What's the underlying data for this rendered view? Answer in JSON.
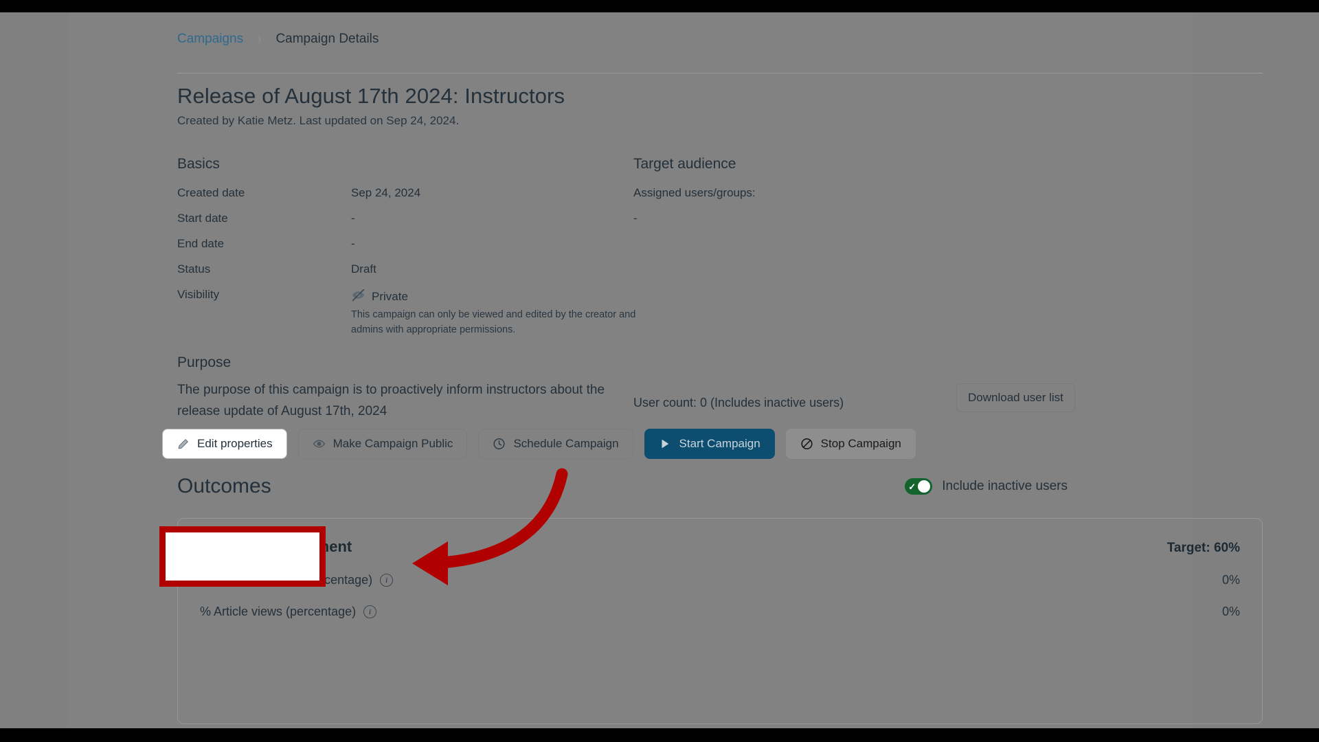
{
  "breadcrumb": {
    "parent": "Campaigns",
    "separator": "›",
    "current": "Campaign Details"
  },
  "header": {
    "title": "Release of August 17th 2024: Instructors",
    "subtitle": "Created by Katie Metz. Last updated on Sep 24, 2024."
  },
  "basics": {
    "heading": "Basics",
    "rows": [
      {
        "label": "Created date",
        "value": "Sep 24, 2024"
      },
      {
        "label": "Start date",
        "value": "-"
      },
      {
        "label": "End date",
        "value": "-"
      },
      {
        "label": "Status",
        "value": "Draft"
      },
      {
        "label": "Visibility",
        "value": "Private",
        "icon": "eye-off-icon"
      }
    ],
    "visibility_note": "This campaign can only be viewed and edited by the creator and admins with appropriate permissions."
  },
  "audience": {
    "heading": "Target audience",
    "assigned_label": "Assigned users/groups:",
    "assigned_value": "-",
    "user_count": "User count: 0 (Includes inactive users)",
    "download_label": "Download user list"
  },
  "purpose": {
    "heading": "Purpose",
    "text": "The purpose of this campaign is to proactively inform instructors about the release update of August 17th, 2024"
  },
  "actions": [
    {
      "label": "Edit properties",
      "icon": "pencil-icon",
      "style": "white"
    },
    {
      "label": "Make Campaign Public",
      "icon": "eye-icon",
      "style": "outline"
    },
    {
      "label": "Schedule Campaign",
      "icon": "clock-icon",
      "style": "outline"
    },
    {
      "label": "Start Campaign",
      "icon": "play-icon",
      "style": "primary"
    },
    {
      "label": "Stop Campaign",
      "icon": "no-entry-icon",
      "style": "muted"
    }
  ],
  "outcomes": {
    "heading": "Outcomes",
    "toggle_label": "Include inactive users",
    "toggle_on": true,
    "card": {
      "title": "Content Engagement",
      "target": "Target: 60%",
      "metrics": [
        {
          "label": "% Message views (percentage)",
          "value": "0%"
        },
        {
          "label": "% Article views (percentage)",
          "value": "0%"
        }
      ]
    }
  },
  "annotation": {
    "highlight_color": "#b00000",
    "target": "Edit properties"
  }
}
